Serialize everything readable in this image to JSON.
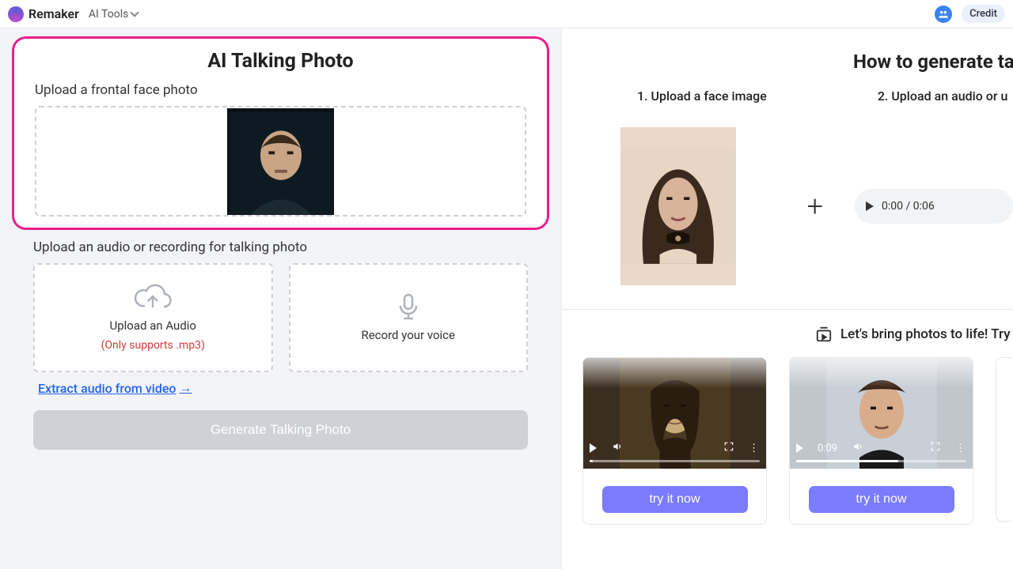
{
  "header": {
    "brand": "Remaker",
    "nav_tools": "AI Tools",
    "credit_label": "Credit"
  },
  "left": {
    "title": "AI Talking Photo",
    "upload_face_label": "Upload a frontal face photo",
    "upload_audio_label": "Upload an audio or recording for talking photo",
    "upload_audio_card": "Upload an Audio",
    "upload_audio_note": "(Only supports .mp3)",
    "record_card": "Record your voice",
    "extract_link": "Extract audio from video",
    "generate_btn": "Generate Talking Photo"
  },
  "right": {
    "title": "How to generate tal",
    "step1": "1. Upload a face image",
    "step2": "2. Upload an audio or u",
    "audio_time": "0:00 / 0:06",
    "bring_text": "Let's bring photos to life! Try",
    "samples": [
      {
        "time": "",
        "progress": 2,
        "try": "try it now"
      },
      {
        "time": "0:09",
        "progress": 60,
        "try": "try it now"
      }
    ]
  }
}
